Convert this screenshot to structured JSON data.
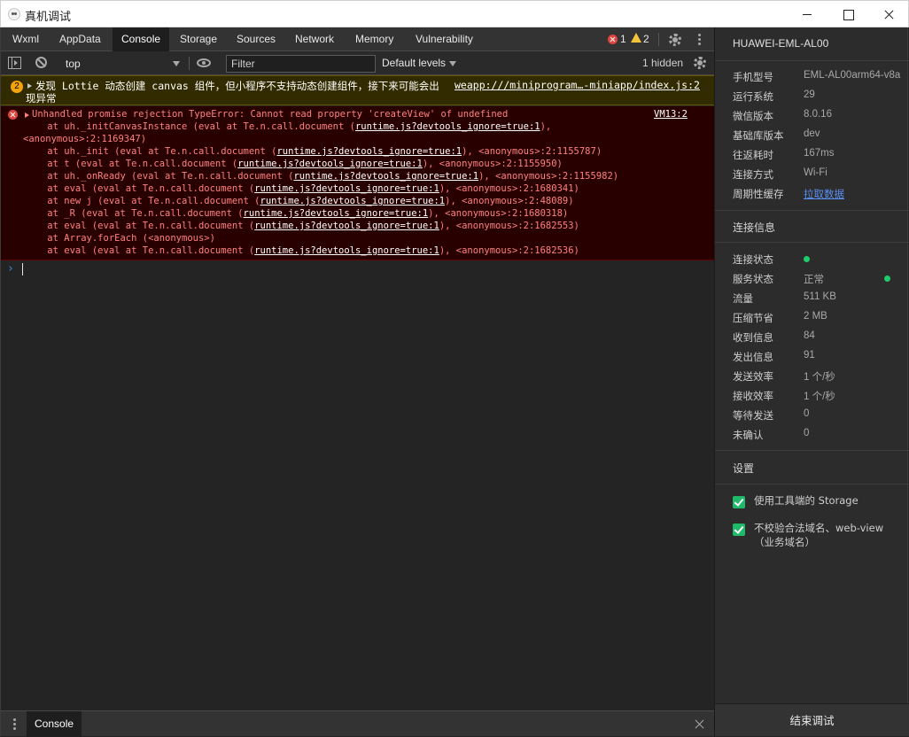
{
  "window": {
    "title": "真机调试"
  },
  "tabs": [
    "Wxml",
    "AppData",
    "Console",
    "Storage",
    "Sources",
    "Network",
    "Memory",
    "Vulnerability"
  ],
  "active_tab": "Console",
  "counts": {
    "errors": "1",
    "warnings": "2"
  },
  "toolbar": {
    "context": "top",
    "filter_placeholder": "Filter",
    "levels": "Default levels",
    "hidden": "1 hidden"
  },
  "console": {
    "warning": {
      "count": "2",
      "text": "发现 Lottie 动态创建 canvas 组件，但小程序不支持动态创建组件，接下来可能会出",
      "text2": "现异常",
      "link": "weapp:///miniprogram…-miniapp/index.js:2"
    },
    "error": {
      "message": "Unhandled promise rejection TypeError: Cannot read property 'createView' of undefined",
      "source": "VM13:2",
      "lines": [
        {
          "pre": "    at uh._initCanvasInstance (eval at Te.n.call.document (",
          "link": "runtime.js?devtools_ignore=true:1",
          "post": "),",
          "indent": 51
        },
        {
          "pre": "<anonymous>:2:1169347)",
          "link": "",
          "post": "",
          "indent": 25
        },
        {
          "pre": "    at uh._init (eval at Te.n.call.document (",
          "link": "runtime.js?devtools_ignore=true:1",
          "post": "), <anonymous>:2:1155787)",
          "indent": 51
        },
        {
          "pre": "    at t (eval at Te.n.call.document (",
          "link": "runtime.js?devtools_ignore=true:1",
          "post": "), <anonymous>:2:1155950)",
          "indent": 51
        },
        {
          "pre": "    at uh._onReady (eval at Te.n.call.document (",
          "link": "runtime.js?devtools_ignore=true:1",
          "post": "), <anonymous>:2:1155982)",
          "indent": 51
        },
        {
          "pre": "    at eval (eval at Te.n.call.document (",
          "link": "runtime.js?devtools_ignore=true:1",
          "post": "), <anonymous>:2:1680341)",
          "indent": 51
        },
        {
          "pre": "    at new j (eval at Te.n.call.document (",
          "link": "runtime.js?devtools_ignore=true:1",
          "post": "), <anonymous>:2:48089)",
          "indent": 51
        },
        {
          "pre": "    at _R (eval at Te.n.call.document (",
          "link": "runtime.js?devtools_ignore=true:1",
          "post": "), <anonymous>:2:1680318)",
          "indent": 51
        },
        {
          "pre": "    at eval (eval at Te.n.call.document (",
          "link": "runtime.js?devtools_ignore=true:1",
          "post": "), <anonymous>:2:1682553)",
          "indent": 51
        },
        {
          "pre": "    at Array.forEach (<anonymous>)",
          "link": "",
          "post": "",
          "indent": 51
        },
        {
          "pre": "    at eval (eval at Te.n.call.document (",
          "link": "runtime.js?devtools_ignore=true:1",
          "post": "), <anonymous>:2:1682536)",
          "indent": 51
        }
      ]
    },
    "prompt": "›"
  },
  "drawer": {
    "tab": "Console"
  },
  "panel": {
    "device": "HUAWEI-EML-AL00",
    "device_info": [
      {
        "key": "手机型号",
        "value": "EML-AL00arm64-v8a"
      },
      {
        "key": "运行系统",
        "value": "29"
      },
      {
        "key": "微信版本",
        "value": "8.0.16"
      },
      {
        "key": "基础库版本",
        "value": "dev"
      },
      {
        "key": "往返耗时",
        "value": "167ms"
      },
      {
        "key": "连接方式",
        "value": "Wi-Fi"
      },
      {
        "key": "周期性缓存",
        "value": "拉取数据"
      }
    ],
    "conn_title": "连接信息",
    "conn_info": [
      {
        "key": "连接状态",
        "value": ""
      },
      {
        "key": "服务状态",
        "value": "正常"
      },
      {
        "key": "流量",
        "value": "511 KB"
      },
      {
        "key": "压缩节省",
        "value": "2 MB"
      },
      {
        "key": "收到信息",
        "value": "84"
      },
      {
        "key": "发出信息",
        "value": "91"
      },
      {
        "key": "发送效率",
        "value": "1 个/秒"
      },
      {
        "key": "接收效率",
        "value": "1 个/秒"
      },
      {
        "key": "等待发送",
        "value": "0"
      },
      {
        "key": "未确认",
        "value": "0"
      }
    ],
    "settings_title": "设置",
    "settings": [
      {
        "label": "使用工具端的 Storage",
        "checked": true
      },
      {
        "label": "不校验合法域名、web-view（业务域名）",
        "checked": true
      }
    ],
    "end_button": "结束调试",
    "accent_green": "#1fcc6b",
    "link_color": "#5b8ef0"
  }
}
